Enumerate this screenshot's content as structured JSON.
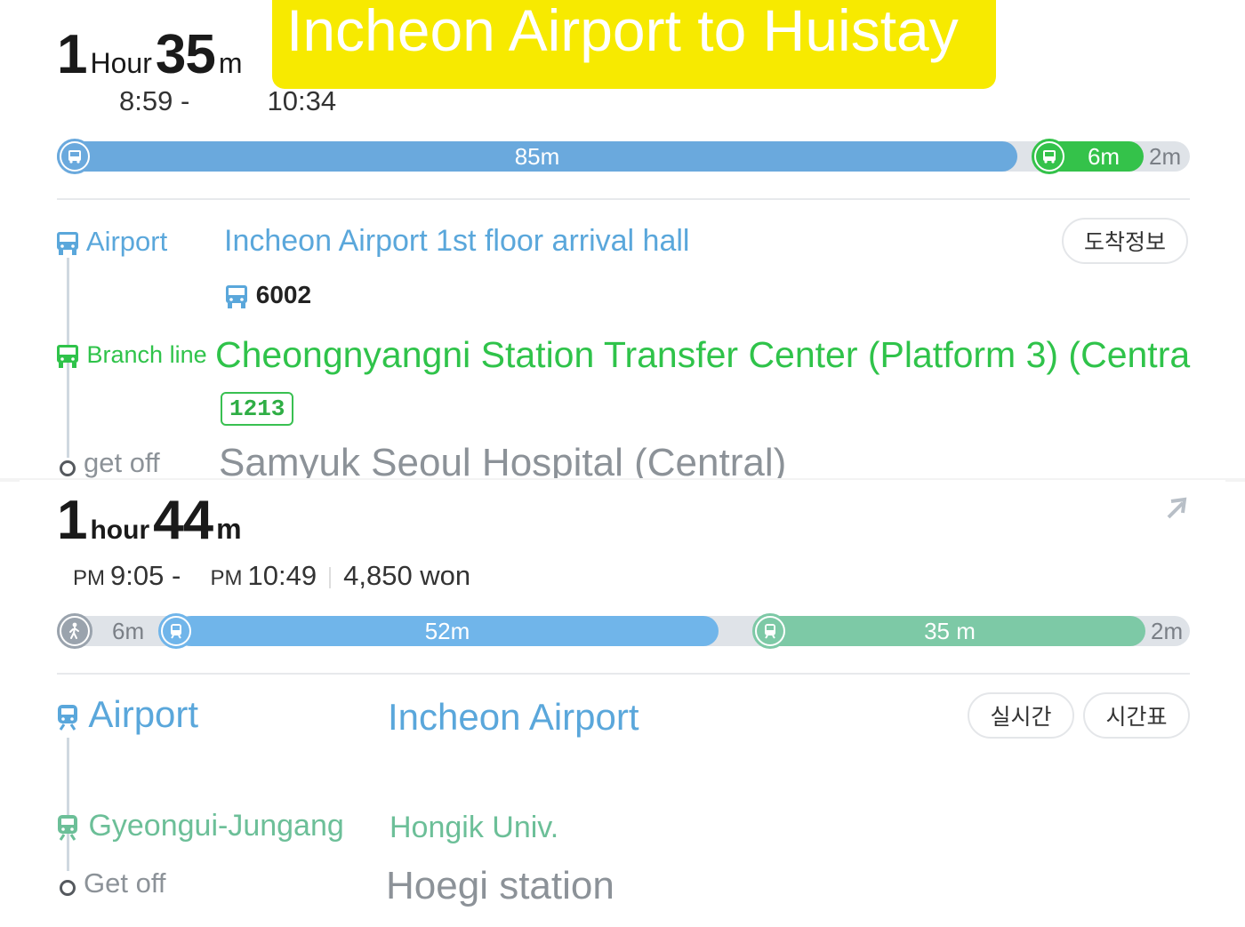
{
  "banner": {
    "title": "Incheon Airport to Huistay"
  },
  "route1": {
    "duration": {
      "hours": "1",
      "hours_unit": "Hour",
      "minutes": "35",
      "minutes_unit": "m"
    },
    "time_start": "8:59 -",
    "time_end": "10:34",
    "bar": {
      "seg1": "85m",
      "seg2": "6m",
      "tail": "2m"
    },
    "legs": [
      {
        "icon": "bus-icon",
        "mode": "Airport",
        "stop": "Incheon Airport 1st floor arrival hall",
        "route": "6002",
        "button": "도착정보"
      },
      {
        "icon": "bus-icon",
        "mode": "Branch line",
        "stop": "Cheongnyangni Station Transfer Center (Platform 3) (Centra",
        "route": "1213"
      },
      {
        "icon": "stop-dot-icon",
        "mode": "get off",
        "stop": "Samyuk Seoul Hospital (Central)"
      }
    ]
  },
  "route2": {
    "duration": {
      "hours": "1",
      "hours_unit": "hour",
      "minutes": "44",
      "minutes_unit": "m"
    },
    "pm_label": "PM",
    "time_start": "9:05 -",
    "time_end": "10:49",
    "fare": "4,850 won",
    "bar": {
      "lead": "6m",
      "seg1": "52m",
      "seg2": "35 m",
      "tail": "2m"
    },
    "legs": [
      {
        "icon": "train-icon",
        "mode": "Airport",
        "stop": "Incheon Airport",
        "buttons": [
          "실시간",
          "시간표"
        ]
      },
      {
        "icon": "train-icon",
        "mode": "Gyeongui-Jungang",
        "stop": "Hongik Univ."
      },
      {
        "icon": "stop-dot-icon",
        "mode": "Get off",
        "stop": "Hoegi station"
      }
    ]
  },
  "colors": {
    "banner": "#f7ea00",
    "bus_blue": "#6aa9dd",
    "bus_green": "#34c24a",
    "subway_blue": "#70b5ea",
    "subway_teal": "#7dc9a6"
  }
}
